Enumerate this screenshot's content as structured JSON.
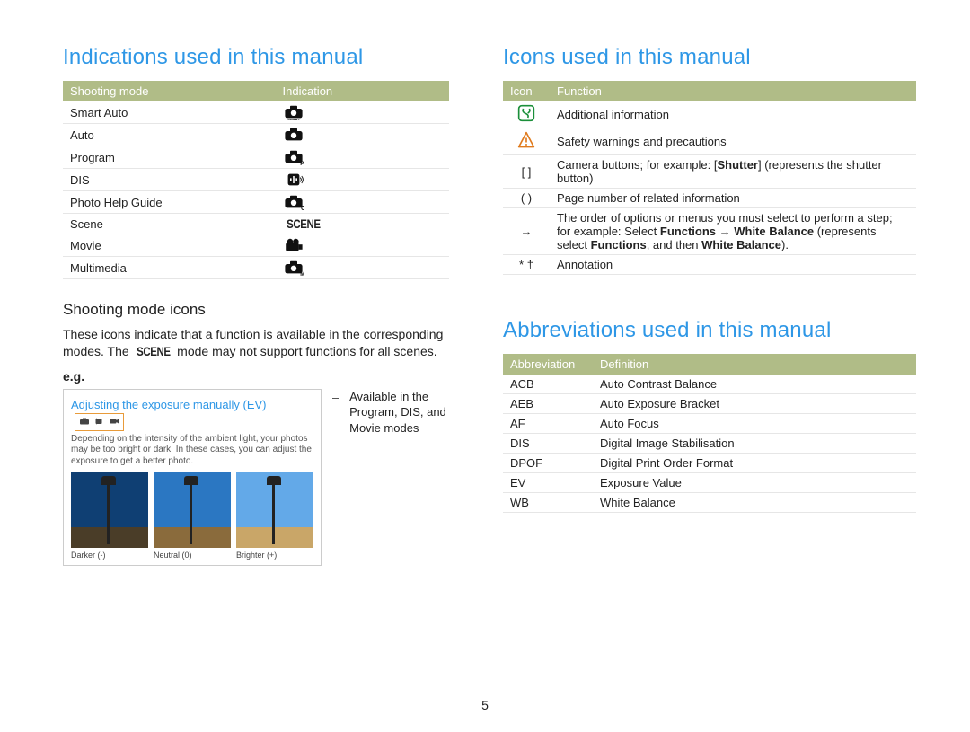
{
  "page_number": "5",
  "left": {
    "heading": "Indications used in this manual",
    "table": {
      "headers": [
        "Shooting mode",
        "Indication"
      ],
      "rows": [
        {
          "mode": "Smart Auto",
          "icon": "smart-auto-icon"
        },
        {
          "mode": "Auto",
          "icon": "auto-icon"
        },
        {
          "mode": "Program",
          "icon": "program-icon"
        },
        {
          "mode": "DIS",
          "icon": "dis-icon"
        },
        {
          "mode": "Photo Help Guide",
          "icon": "help-guide-icon"
        },
        {
          "mode": "Scene",
          "icon": "scene-icon"
        },
        {
          "mode": "Movie",
          "icon": "movie-icon"
        },
        {
          "mode": "Multimedia",
          "icon": "multimedia-icon"
        }
      ]
    },
    "subhead": "Shooting mode icons",
    "body_pre": "These icons indicate that a function is available in the corresponding modes. The ",
    "body_post": " mode may not support functions for all scenes.",
    "eg_label": "e.g.",
    "example": {
      "title": "Adjusting the exposure manually (EV)",
      "desc": "Depending on the intensity of the ambient light, your photos may be too bright or dark. In these cases, you can adjust the exposure to get a better photo.",
      "samples": [
        {
          "caption": "Darker (-)",
          "sky": "#0f3f73",
          "ground": "#4a3d28"
        },
        {
          "caption": "Neutral (0)",
          "sky": "#2b77c2",
          "ground": "#8a6b3c"
        },
        {
          "caption": "Brighter (+)",
          "sky": "#63a9e8",
          "ground": "#c9a668"
        }
      ]
    },
    "callout": "Available in the Program, DIS, and Movie modes"
  },
  "right": {
    "icons_heading": "Icons used in this manual",
    "icons_table": {
      "headers": [
        "Icon",
        "Function"
      ],
      "rows": [
        {
          "icon": "info-icon",
          "symbol": "",
          "html": "Additional information"
        },
        {
          "icon": "warn-icon",
          "symbol": "",
          "html": "Safety warnings and precautions"
        },
        {
          "icon": "",
          "symbol": "[ ]",
          "html": "Camera buttons; for example: [<b>Shutter</b>] (represents the shutter button)"
        },
        {
          "icon": "",
          "symbol": "( )",
          "html": "Page number of related information"
        },
        {
          "icon": "",
          "symbol": "→",
          "html": "The order of options or menus you must select to perform a step; for example: Select <b>Functions</b> → <b>White Balance</b> (represents select <b>Functions</b>, and then <b>White Balance</b>)."
        },
        {
          "icon": "",
          "symbol": "* †",
          "html": "Annotation"
        }
      ]
    },
    "abbrev_heading": "Abbreviations used in this manual",
    "abbrev_table": {
      "headers": [
        "Abbreviation",
        "Definition"
      ],
      "rows": [
        {
          "abbr": "ACB",
          "def": "Auto Contrast Balance"
        },
        {
          "abbr": "AEB",
          "def": "Auto Exposure Bracket"
        },
        {
          "abbr": "AF",
          "def": "Auto Focus"
        },
        {
          "abbr": "DIS",
          "def": "Digital Image Stabilisation"
        },
        {
          "abbr": "DPOF",
          "def": "Digital Print Order Format"
        },
        {
          "abbr": "EV",
          "def": "Exposure Value"
        },
        {
          "abbr": "WB",
          "def": "White Balance"
        }
      ]
    }
  }
}
